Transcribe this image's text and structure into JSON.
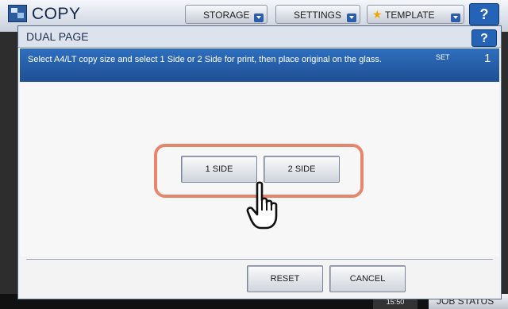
{
  "app": {
    "title": "COPY",
    "tabs": [
      {
        "label": "STORAGE"
      },
      {
        "label": "SETTINGS"
      },
      {
        "label": "TEMPLATE"
      }
    ],
    "help": "?"
  },
  "dialog": {
    "title": "DUAL PAGE",
    "help": "?",
    "message": "Select A4/LT copy size and select 1 Side or 2 Side for print, then place original on the glass.",
    "set_label": "SET",
    "set_count": "1",
    "option_buttons": [
      {
        "label": "1 SIDE"
      },
      {
        "label": "2 SIDE"
      }
    ],
    "reset_label": "RESET",
    "cancel_label": "CANCEL"
  },
  "status_bar": {
    "clock": "15:50",
    "job_status": "JOB STATUS"
  },
  "colors": {
    "message_band": "#2a65b3",
    "highlight_ring": "#e8866d",
    "help_button": "#2563b6"
  },
  "icons": [
    "copy-app-icon",
    "star-icon",
    "pointing-hand-icon",
    "dropdown-arrow-icon"
  ]
}
